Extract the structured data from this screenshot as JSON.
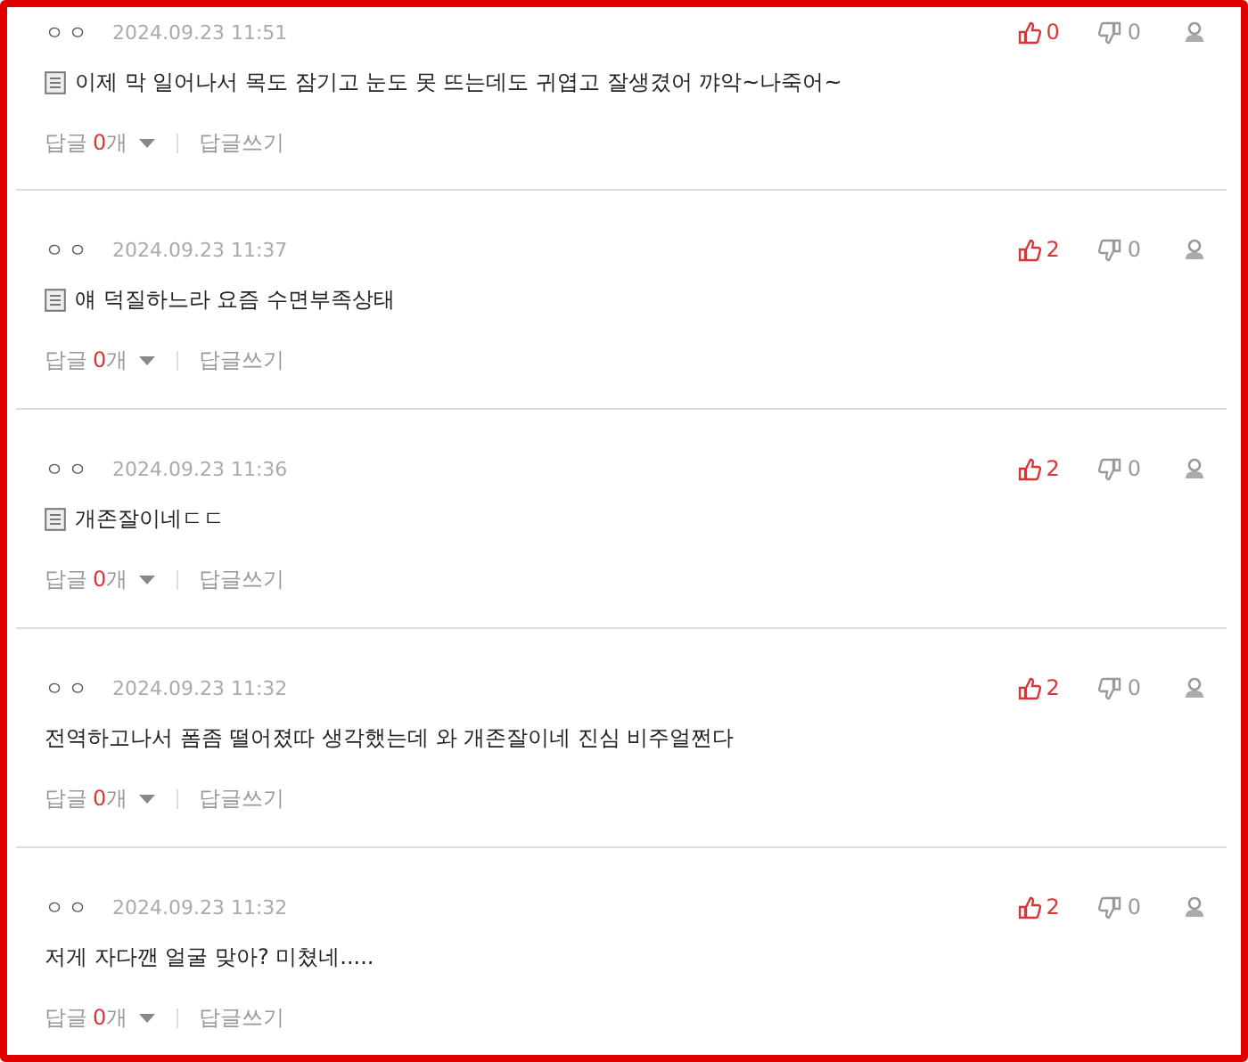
{
  "comments": [
    {
      "author": "ㅇㅇ",
      "date": "2024.09.23 11:51",
      "attachment": true,
      "text": "이제 막 일어나서 목도 잠기고 눈도 못 뜨는데도 귀엽고 잘생겼어 꺄악~나죽어~",
      "likes": "0",
      "dislikes": "0",
      "reply_label": "답글",
      "reply_count": "0",
      "reply_unit": "개",
      "write_reply": "답글쓰기"
    },
    {
      "author": "ㅇㅇ",
      "date": "2024.09.23 11:37",
      "attachment": true,
      "text": "얘 덕질하느라 요즘 수면부족상태",
      "likes": "2",
      "dislikes": "0",
      "reply_label": "답글",
      "reply_count": "0",
      "reply_unit": "개",
      "write_reply": "답글쓰기"
    },
    {
      "author": "ㅇㅇ",
      "date": "2024.09.23 11:36",
      "attachment": true,
      "text": "개존잘이네ㄷㄷ",
      "likes": "2",
      "dislikes": "0",
      "reply_label": "답글",
      "reply_count": "0",
      "reply_unit": "개",
      "write_reply": "답글쓰기"
    },
    {
      "author": "ㅇㅇ",
      "date": "2024.09.23 11:32",
      "attachment": false,
      "text": "전역하고나서 폼좀 떨어졌따 생각했는데 와 개존잘이네 진심 비주얼쩐다",
      "likes": "2",
      "dislikes": "0",
      "reply_label": "답글",
      "reply_count": "0",
      "reply_unit": "개",
      "write_reply": "답글쓰기"
    },
    {
      "author": "ㅇㅇ",
      "date": "2024.09.23 11:32",
      "attachment": false,
      "text": "저게 자다깬 얼굴 맞아? 미쳤네.....",
      "likes": "2",
      "dislikes": "0",
      "reply_label": "답글",
      "reply_count": "0",
      "reply_unit": "개",
      "write_reply": "답글쓰기"
    }
  ]
}
